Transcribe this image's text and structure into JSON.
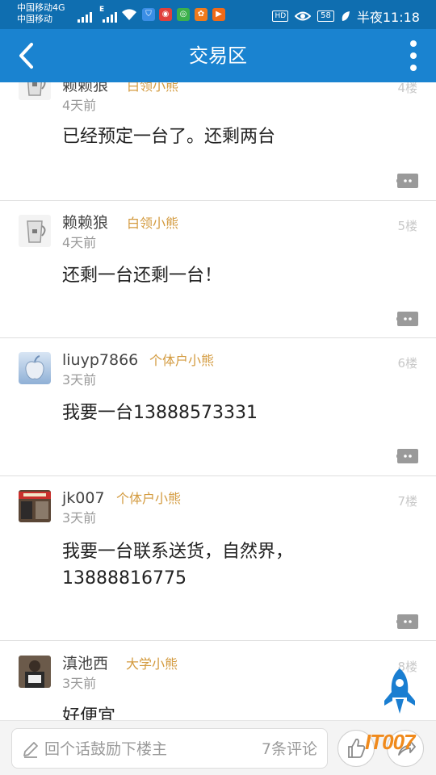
{
  "status_bar": {
    "carrier_line1": "中国移动4G",
    "carrier_line2": "中国移动",
    "net_4g": "4G",
    "net_e": "E",
    "hd": "HD",
    "battery": "58",
    "time": "半夜11:18"
  },
  "header": {
    "title": "交易区"
  },
  "comments": [
    {
      "username": "赖赖狼",
      "badge": "白领小熊",
      "floor": "4楼",
      "time": "4天前",
      "body": "已经预定一台了。还剩两台"
    },
    {
      "username": "赖赖狼",
      "badge": "白领小熊",
      "floor": "5楼",
      "time": "4天前",
      "body": "还剩一台还剩一台！"
    },
    {
      "username": "liuyp7866",
      "badge": "个体户小熊",
      "floor": "6楼",
      "time": "3天前",
      "body": "我要一台13888573331"
    },
    {
      "username": "jk007",
      "badge": "个体户小熊",
      "floor": "7楼",
      "time": "3天前",
      "body": "我要一台联系送货，自然界，13888816775"
    },
    {
      "username": "滇池西",
      "badge": "大学小熊",
      "floor": "8楼",
      "time": "3天前",
      "body": "好便宜"
    }
  ],
  "bottom_bar": {
    "reply_placeholder": "回个话鼓励下楼主",
    "comment_count": "7条评论"
  },
  "watermark": "IT007",
  "colors": {
    "status_bar": "#0f6eb0",
    "app_bar": "#1a83d0",
    "badge": "#d39a3e",
    "floor": "#c8c8c8",
    "rocket": "#1a7ed1"
  },
  "icons": {
    "back": "chevron-left-icon",
    "more": "more-vertical-icon",
    "reply": "speech-bubble-icon",
    "scroll_top": "rocket-icon",
    "edit": "pencil-icon",
    "like": "thumbs-up-icon",
    "share": "share-icon"
  }
}
